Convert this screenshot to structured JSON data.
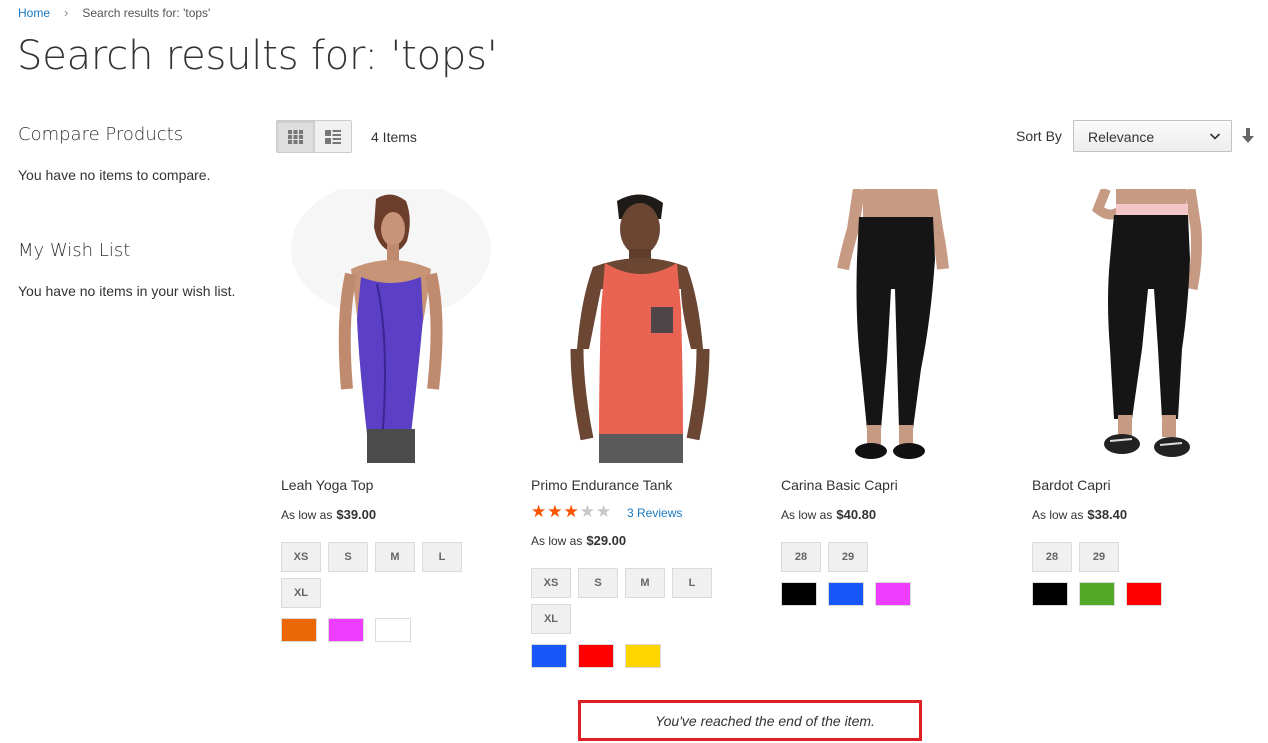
{
  "breadcrumb": {
    "home": "Home",
    "current": "Search results for: 'tops'"
  },
  "page_title": "Search results for: 'tops'",
  "sidebar": {
    "compare_title": "Compare Products",
    "compare_text": "You have no items to compare.",
    "wishlist_title": "My Wish List",
    "wishlist_text": "You have no items in your wish list."
  },
  "toolbar": {
    "amount": "4 Items",
    "sort_label": "Sort By",
    "sort_value": "Relevance",
    "view_modes": [
      "grid",
      "list"
    ],
    "active_mode": "grid"
  },
  "products": [
    {
      "name": "Leah Yoga Top",
      "price_prefix": "As low as",
      "price": "$39.00",
      "sizes": [
        "XS",
        "S",
        "M",
        "L",
        "XL"
      ],
      "colors": [
        "#eb6703",
        "#ef3dff",
        "#ffffff"
      ]
    },
    {
      "name": "Primo Endurance Tank",
      "rating": 0.53,
      "reviews": "3 Reviews",
      "price_prefix": "As low as",
      "price": "$29.00",
      "sizes": [
        "XS",
        "S",
        "M",
        "L",
        "XL"
      ],
      "colors": [
        "#1857f7",
        "#ff0000",
        "#ffd500"
      ]
    },
    {
      "name": "Carina Basic Capri",
      "price_prefix": "As low as",
      "price": "$40.80",
      "sizes": [
        "28",
        "29"
      ],
      "colors": [
        "#000000",
        "#1857f7",
        "#ef3dff"
      ]
    },
    {
      "name": "Bardot Capri",
      "price_prefix": "As low as",
      "price": "$38.40",
      "sizes": [
        "28",
        "29"
      ],
      "colors": [
        "#000000",
        "#53a828",
        "#ff0000"
      ]
    }
  ],
  "end_message": "You've reached the end of the item."
}
